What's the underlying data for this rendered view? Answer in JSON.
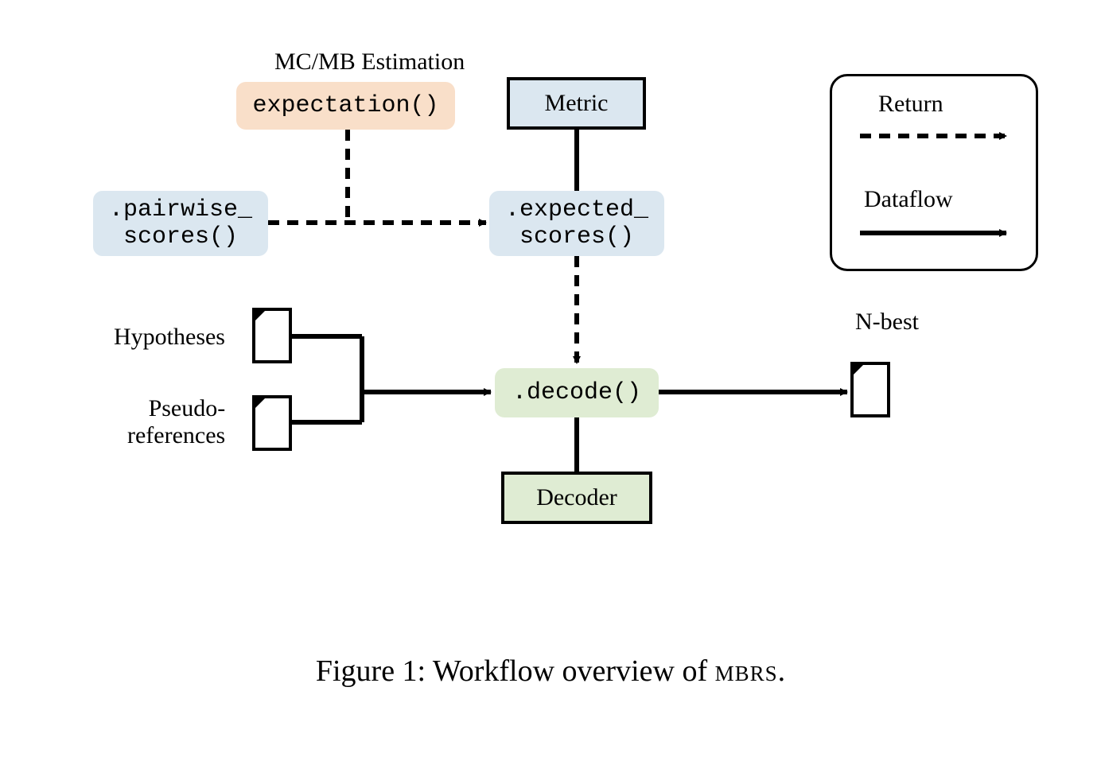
{
  "estimation_label": "MC/MB Estimation",
  "expectation_box": "expectation()",
  "pairwise_box": ".pairwise_\nscores()",
  "expected_box": ".expected_\nscores()",
  "metric_box": "Metric",
  "decode_box": ".decode()",
  "decoder_box": "Decoder",
  "hypotheses_label": "Hypotheses",
  "pseudo_label": "Pseudo-\nreferences",
  "nbest_label": "N-best",
  "legend_return": "Return",
  "legend_dataflow": "Dataflow",
  "caption_prefix": "Figure 1: Workflow overview of ",
  "caption_name": "mbrs",
  "caption_suffix": "."
}
